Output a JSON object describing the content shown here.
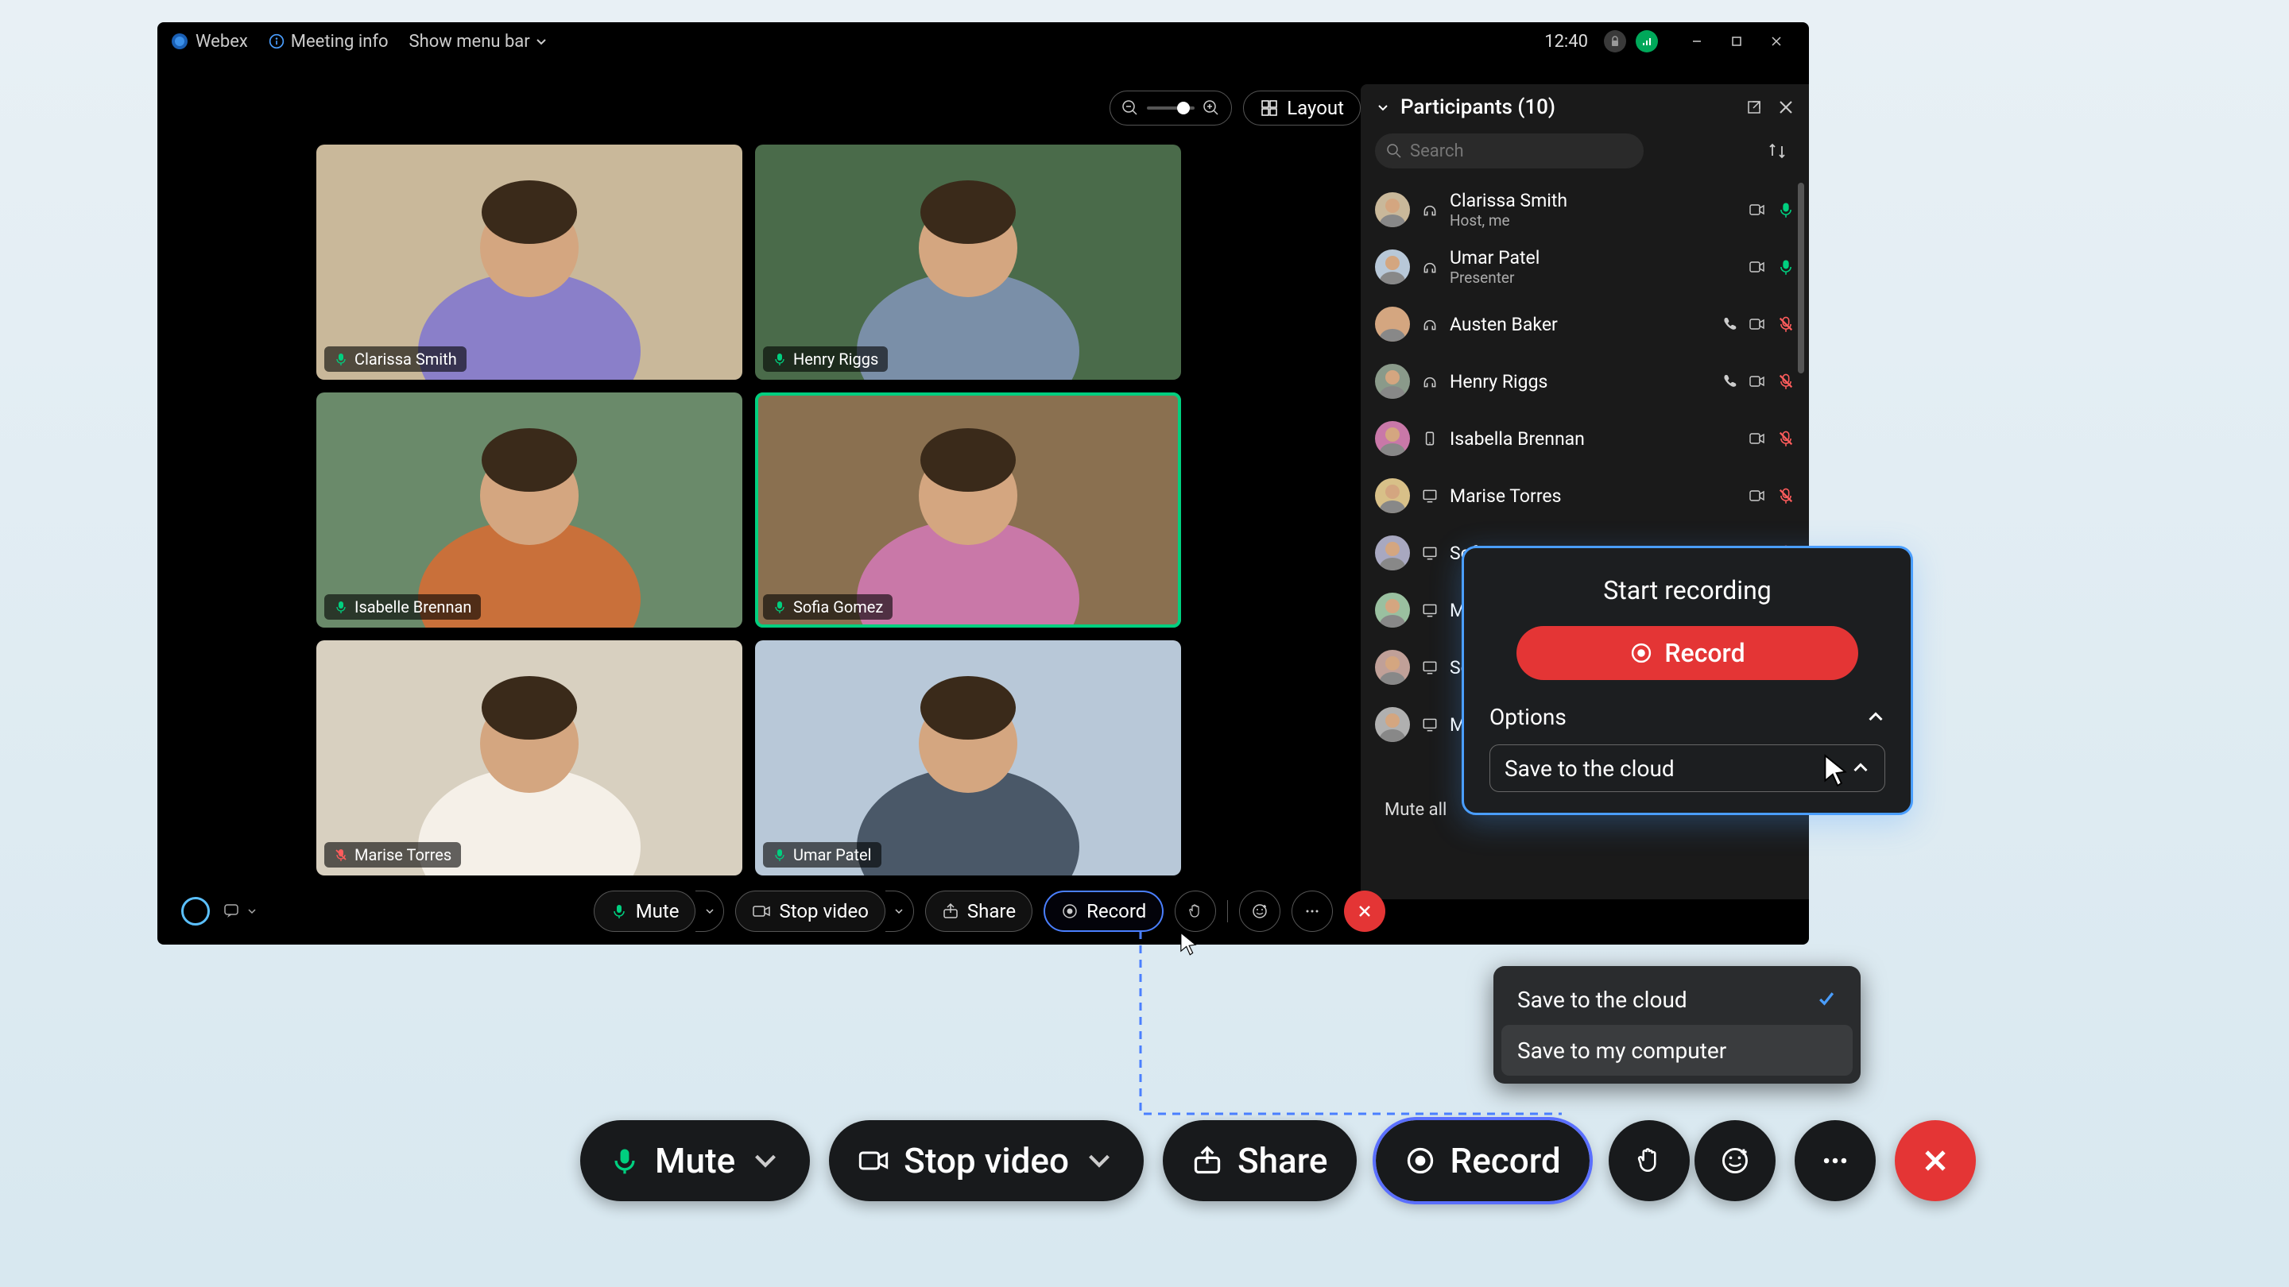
{
  "titlebar": {
    "app_name": "Webex",
    "meeting_info": "Meeting info",
    "show_menubar": "Show menu bar",
    "time": "12:40"
  },
  "top_controls": {
    "layout_label": "Layout"
  },
  "video_tiles": [
    {
      "name": "Clarissa Smith",
      "mic_on": true,
      "active": false,
      "bg": "#c9b89a",
      "shirt": "#8a7fc9"
    },
    {
      "name": "Henry Riggs",
      "mic_on": true,
      "active": false,
      "bg": "#4a6b4a",
      "shirt": "#7a8fa8"
    },
    {
      "name": "Isabelle Brennan",
      "mic_on": true,
      "active": false,
      "bg": "#6a8a6a",
      "shirt": "#c9703a"
    },
    {
      "name": "Sofia Gomez",
      "mic_on": true,
      "active": true,
      "bg": "#8a7050",
      "shirt": "#c978a8"
    },
    {
      "name": "Marise Torres",
      "mic_on": false,
      "active": false,
      "bg": "#d8d0c0",
      "shirt": "#f5f0e8"
    },
    {
      "name": "Umar Patel",
      "mic_on": true,
      "active": false,
      "bg": "#b8c8d8",
      "shirt": "#4a5868"
    }
  ],
  "participants": {
    "header": "Participants (10)",
    "search_placeholder": "Search",
    "mute_all": "Mute all",
    "list": [
      {
        "name": "Clarissa Smith",
        "role": "Host, me",
        "video": true,
        "mic_on": true,
        "device": "headset"
      },
      {
        "name": "Umar Patel",
        "role": "Presenter",
        "video": true,
        "mic_on": true,
        "device": "headset-share"
      },
      {
        "name": "Austen Baker",
        "role": "",
        "video": true,
        "mic_on": false,
        "device": "headset",
        "phone": true
      },
      {
        "name": "Henry Riggs",
        "role": "",
        "video": true,
        "mic_on": false,
        "device": "headset",
        "phone": true
      },
      {
        "name": "Isabella Brennan",
        "role": "",
        "video": true,
        "mic_on": false,
        "device": "mobile"
      },
      {
        "name": "Marise Torres",
        "role": "",
        "video": true,
        "mic_on": false,
        "device": "desktop"
      },
      {
        "name": "Sof",
        "role": "",
        "video": false,
        "mic_on": false,
        "device": "desktop"
      },
      {
        "name": "Mu",
        "role": "",
        "video": false,
        "mic_on": false,
        "device": "desktop"
      },
      {
        "name": "Son",
        "role": "",
        "video": false,
        "mic_on": false,
        "device": "desktop"
      },
      {
        "name": "Ma",
        "role": "",
        "video": false,
        "mic_on": false,
        "device": "desktop"
      }
    ]
  },
  "bottom": {
    "mute": "Mute",
    "stop_video": "Stop video",
    "share": "Share",
    "record": "Record"
  },
  "record_popup": {
    "title": "Start recording",
    "button": "Record",
    "options_label": "Options",
    "select_value": "Save to the cloud"
  },
  "dropdown": {
    "option1": "Save to the cloud",
    "option2": "Save to my computer"
  }
}
